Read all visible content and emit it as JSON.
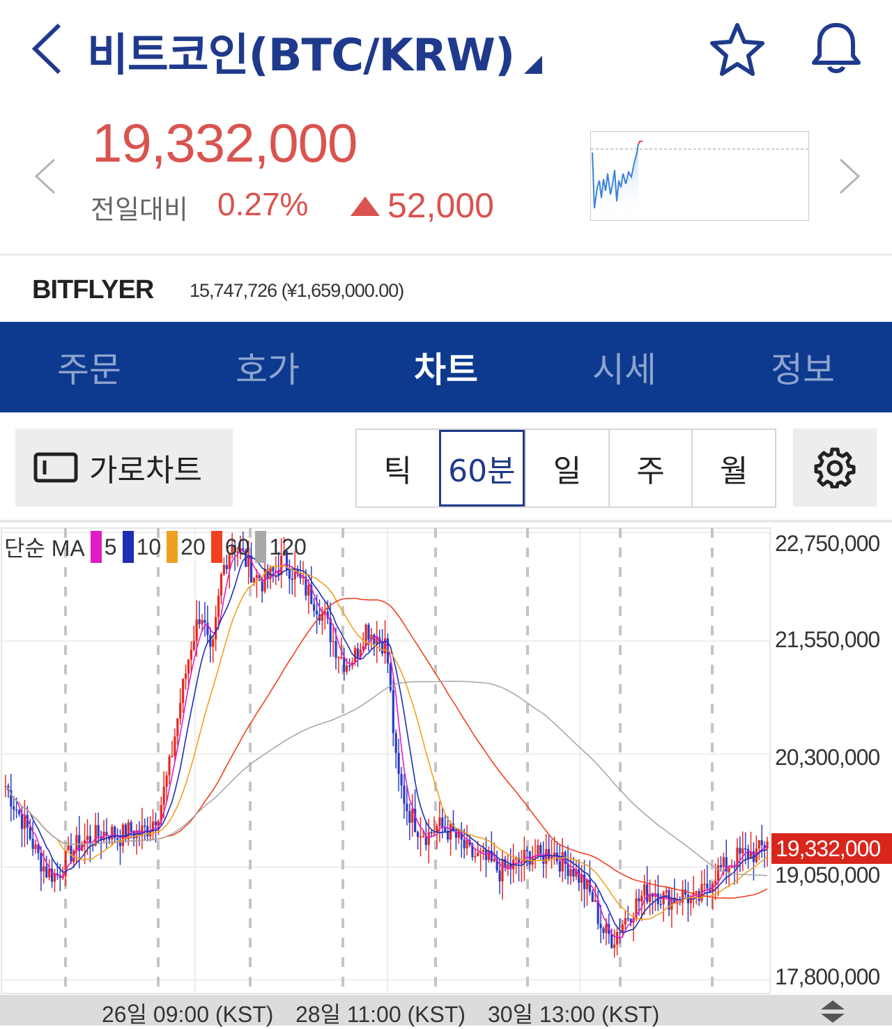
{
  "header": {
    "title": "비트코인(BTC/KRW)"
  },
  "price": {
    "current": "19,332,000",
    "change_label": "전일대비",
    "change_pct": "0.27%",
    "change_amount": "52,000"
  },
  "exchange": {
    "name": "BITFLYER",
    "value": "15,747,726 (¥1,659,000.00)"
  },
  "tabs": [
    "주문",
    "호가",
    "차트",
    "시세",
    "정보"
  ],
  "active_tab": "차트",
  "controls": {
    "landscape_label": "가로차트",
    "periods": [
      "틱",
      "60분",
      "일",
      "주",
      "월"
    ],
    "active_period": "60분"
  },
  "colors": {
    "up": "#e8281e",
    "down": "#2a3cc8",
    "accent": "#0d3a8e",
    "price": "#d9534f"
  },
  "icons": [
    "back-icon",
    "star-icon",
    "bell-icon",
    "landscape-icon",
    "gear-icon"
  ],
  "chart_data": {
    "type": "candlestick",
    "legend": {
      "title": "단순 MA",
      "periods": [
        "5",
        "10",
        "20",
        "60",
        "120"
      ],
      "colors": [
        "#e01cc6",
        "#1b2fb5",
        "#f0a020",
        "#f04020",
        "#a8a8a8"
      ]
    },
    "y_ticks": [
      "22,750,000",
      "21,550,000",
      "20,300,000",
      "19,050,000",
      "17,800,000"
    ],
    "y_tick_values": [
      22750000,
      21550000,
      20300000,
      19050000,
      17800000
    ],
    "x_ticks": [
      "26일 09:00 (KST)",
      "28일 11:00 (KST)",
      "30일 13:00 (KST)"
    ],
    "current_price": "19,332,000",
    "ylim": [
      17650000,
      22800000
    ],
    "closes": [
      19950000,
      19700000,
      19500000,
      19200000,
      19000000,
      18950000,
      19150000,
      19300000,
      19350000,
      19400000,
      19450000,
      19380000,
      19450000,
      19420000,
      19500000,
      19700000,
      20200000,
      20900000,
      21500000,
      21900000,
      21300000,
      22300000,
      22650000,
      22500000,
      22300000,
      22200000,
      22300000,
      22450000,
      22300000,
      22150000,
      22000000,
      21800000,
      21500000,
      21300000,
      21400000,
      21700000,
      21600000,
      21500000,
      20100000,
      19700000,
      19500000,
      19400000,
      19500000,
      19450000,
      19350000,
      19200000,
      19150000,
      19100000,
      19000000,
      19050000,
      19100000,
      19200000,
      19150000,
      19250000,
      19100000,
      19050000,
      18900000,
      18700000,
      18350000,
      18250000,
      18450000,
      18600000,
      18750000,
      18800000,
      18700000,
      18700000,
      18750000,
      18650000,
      18800000,
      19000000,
      19050000,
      19150000,
      19200000,
      19200000,
      19332000
    ]
  }
}
